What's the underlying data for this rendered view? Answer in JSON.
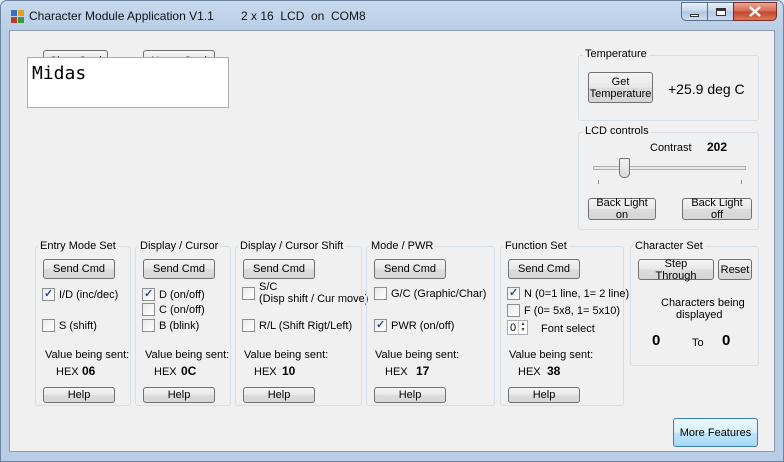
{
  "window": {
    "app_title": "Character Module Application V1.1",
    "lcd_type": "2 x 16  LCD",
    "connection": "on  COM8"
  },
  "top_buttons": {
    "clear": "Clear Cmd",
    "home": "Home Cmd"
  },
  "lcd_display": {
    "text": "Midas"
  },
  "temperature": {
    "title": "Temperature",
    "get_button": "Get\nTemperature",
    "reading": "+25.9 deg C"
  },
  "lcd_controls": {
    "title": "LCD controls",
    "contrast_label": "Contrast",
    "contrast_value": "202",
    "slider_fraction": 0.18,
    "backlight_on": "Back Light on",
    "backlight_off": "Back Light off"
  },
  "entry_mode": {
    "title": "Entry Mode Set",
    "send": "Send Cmd",
    "opt1": "I/D (inc/dec)",
    "opt1_checked": true,
    "opt2": "S (shift)",
    "opt2_checked": false,
    "value_label": "Value being sent:",
    "hex_label": "HEX",
    "hex_value": "06",
    "help": "Help"
  },
  "display_cursor": {
    "title": "Display / Cursor",
    "send": "Send Cmd",
    "opt1": "D (on/off)",
    "opt1_checked": true,
    "opt2": "C (on/off)",
    "opt2_checked": false,
    "opt3": "B (blink)",
    "opt3_checked": false,
    "value_label": "Value being sent:",
    "hex_label": "HEX",
    "hex_value": "0C",
    "help": "Help"
  },
  "display_shift": {
    "title": "Display / Cursor Shift",
    "send": "Send Cmd",
    "opt1_line1": "S/C",
    "opt1_line2": "(Disp shift / Cur move)",
    "opt1_checked": false,
    "opt2": "R/L (Shift Rigt/Left)",
    "opt2_checked": false,
    "value_label": "Value being sent:",
    "hex_label": "HEX",
    "hex_value": "10",
    "help": "Help"
  },
  "mode_pwr": {
    "title": "Mode / PWR",
    "send": "Send Cmd",
    "opt1": "G/C (Graphic/Char)",
    "opt1_checked": false,
    "opt2": "PWR (on/off)",
    "opt2_checked": true,
    "value_label": "Value being sent:",
    "hex_label": "HEX",
    "hex_value": "17",
    "help": "Help"
  },
  "function_set": {
    "title": "Function Set",
    "send": "Send Cmd",
    "opt1": "N (0=1 line, 1= 2 line)",
    "opt1_checked": true,
    "opt2": "F (0= 5x8, 1= 5x10)",
    "opt2_checked": false,
    "font_value": "0",
    "font_label": "Font select",
    "value_label": "Value being sent:",
    "hex_label": "HEX",
    "hex_value": "38",
    "help": "Help"
  },
  "character_set": {
    "title": "Character Set",
    "step": "Step Through",
    "reset": "Reset",
    "caption_line1": "Characters being",
    "caption_line2": "displayed",
    "from": "0",
    "to_label": "To",
    "to": "0"
  },
  "more_features": "More Features"
}
